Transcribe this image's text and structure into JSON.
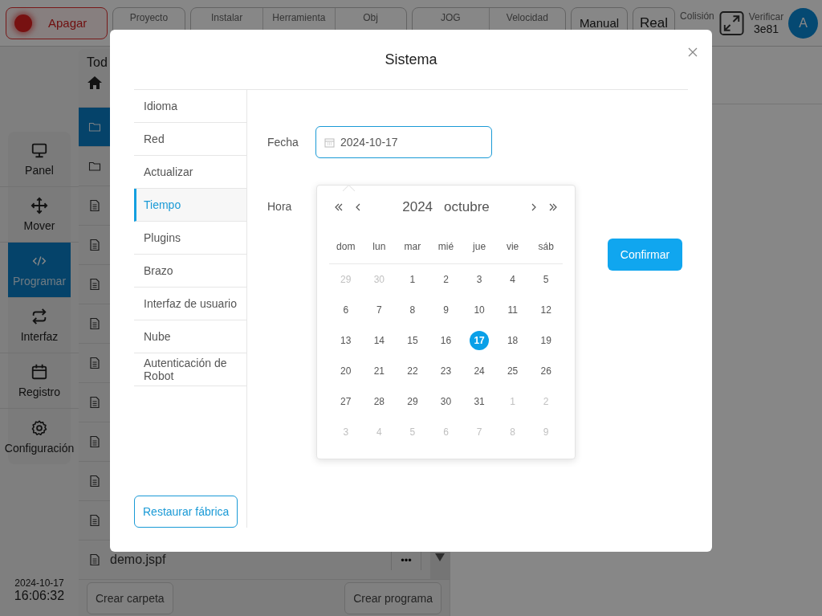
{
  "top_bar": {
    "power_button": {
      "label": "Apagar"
    },
    "status_groups": [
      [
        {
          "label": "Proyecto"
        }
      ],
      [
        {
          "label": "Instalar"
        },
        {
          "label": "Herramienta"
        },
        {
          "label": "Obj"
        }
      ],
      [
        {
          "label": "JOG"
        },
        {
          "label": "Velocidad"
        }
      ]
    ],
    "mode_buttons": [
      "Manual",
      "Real"
    ],
    "collision": {
      "label": "Colisión"
    },
    "verify": {
      "label": "Verificar",
      "value": "3e81"
    },
    "avatar": "A"
  },
  "nav": [
    {
      "label": "Panel",
      "selected": false
    },
    {
      "label": "Mover",
      "selected": false
    },
    {
      "label": "Programar",
      "selected": true
    },
    {
      "label": "Interfaz",
      "selected": false
    },
    {
      "label": "Registro",
      "selected": false
    },
    {
      "label": "Configuración",
      "selected": false
    }
  ],
  "clock": {
    "date": "2024-10-17",
    "time": "16:06:32"
  },
  "file_panel": {
    "header": "Tod",
    "rows": [
      {
        "kind": "folder",
        "selected": true
      },
      {
        "kind": "folder",
        "selected": false
      },
      {
        "kind": "file",
        "selected": false
      },
      {
        "kind": "file",
        "selected": false
      },
      {
        "kind": "file",
        "selected": false
      },
      {
        "kind": "file",
        "selected": false
      },
      {
        "kind": "file",
        "selected": false
      },
      {
        "kind": "file",
        "selected": false
      },
      {
        "kind": "file",
        "selected": false
      },
      {
        "kind": "file",
        "selected": false
      },
      {
        "kind": "file",
        "selected": false
      },
      {
        "kind": "file",
        "selected": false,
        "name": "demo.jspf",
        "more": "•••"
      }
    ],
    "buttons": [
      "Crear carpeta",
      "Crear programa"
    ]
  },
  "dialog": {
    "title": "Sistema",
    "menu": [
      {
        "label": "Idioma",
        "selected": false
      },
      {
        "label": "Red",
        "selected": false
      },
      {
        "label": "Actualizar",
        "selected": false
      },
      {
        "label": "Tiempo",
        "selected": true
      },
      {
        "label": "Plugins",
        "selected": false
      },
      {
        "label": "Brazo",
        "selected": false
      },
      {
        "label": "Interfaz de usuario",
        "selected": false
      },
      {
        "label": "Nube",
        "selected": false
      },
      {
        "label": "Autenticación de Robot",
        "selected": false
      }
    ],
    "restore_button": "Restaurar fábrica",
    "date_label": "Fecha",
    "date_value": "2024-10-17",
    "time_label": "Hora",
    "confirm_button": "Confirmar",
    "calendar": {
      "year": "2024",
      "month": "octubre",
      "weekdays": [
        "dom",
        "lun",
        "mar",
        "mié",
        "jue",
        "vie",
        "sáb"
      ],
      "weeks": [
        [
          {
            "day": "29",
            "outside_month": true,
            "selected": false
          },
          {
            "day": "30",
            "outside_month": true,
            "selected": false
          },
          {
            "day": "1",
            "outside_month": false,
            "selected": false
          },
          {
            "day": "2",
            "outside_month": false,
            "selected": false
          },
          {
            "day": "3",
            "outside_month": false,
            "selected": false
          },
          {
            "day": "4",
            "outside_month": false,
            "selected": false
          },
          {
            "day": "5",
            "outside_month": false,
            "selected": false
          }
        ],
        [
          {
            "day": "6",
            "outside_month": false,
            "selected": false
          },
          {
            "day": "7",
            "outside_month": false,
            "selected": false
          },
          {
            "day": "8",
            "outside_month": false,
            "selected": false
          },
          {
            "day": "9",
            "outside_month": false,
            "selected": false
          },
          {
            "day": "10",
            "outside_month": false,
            "selected": false
          },
          {
            "day": "11",
            "outside_month": false,
            "selected": false
          },
          {
            "day": "12",
            "outside_month": false,
            "selected": false
          }
        ],
        [
          {
            "day": "13",
            "outside_month": false,
            "selected": false
          },
          {
            "day": "14",
            "outside_month": false,
            "selected": false
          },
          {
            "day": "15",
            "outside_month": false,
            "selected": false
          },
          {
            "day": "16",
            "outside_month": false,
            "selected": false
          },
          {
            "day": "17",
            "outside_month": false,
            "selected": true
          },
          {
            "day": "18",
            "outside_month": false,
            "selected": false
          },
          {
            "day": "19",
            "outside_month": false,
            "selected": false
          }
        ],
        [
          {
            "day": "20",
            "outside_month": false,
            "selected": false
          },
          {
            "day": "21",
            "outside_month": false,
            "selected": false
          },
          {
            "day": "22",
            "outside_month": false,
            "selected": false
          },
          {
            "day": "23",
            "outside_month": false,
            "selected": false
          },
          {
            "day": "24",
            "outside_month": false,
            "selected": false
          },
          {
            "day": "25",
            "outside_month": false,
            "selected": false
          },
          {
            "day": "26",
            "outside_month": false,
            "selected": false
          }
        ],
        [
          {
            "day": "27",
            "outside_month": false,
            "selected": false
          },
          {
            "day": "28",
            "outside_month": false,
            "selected": false
          },
          {
            "day": "29",
            "outside_month": false,
            "selected": false
          },
          {
            "day": "30",
            "outside_month": false,
            "selected": false
          },
          {
            "day": "31",
            "outside_month": false,
            "selected": false
          },
          {
            "day": "1",
            "outside_month": true,
            "selected": false
          },
          {
            "day": "2",
            "outside_month": true,
            "selected": false
          }
        ],
        [
          {
            "day": "3",
            "outside_month": true,
            "selected": false
          },
          {
            "day": "4",
            "outside_month": true,
            "selected": false
          },
          {
            "day": "5",
            "outside_month": true,
            "selected": false
          },
          {
            "day": "6",
            "outside_month": true,
            "selected": false
          },
          {
            "day": "7",
            "outside_month": true,
            "selected": false
          },
          {
            "day": "8",
            "outside_month": true,
            "selected": false
          },
          {
            "day": "9",
            "outside_month": true,
            "selected": false
          }
        ]
      ]
    }
  }
}
